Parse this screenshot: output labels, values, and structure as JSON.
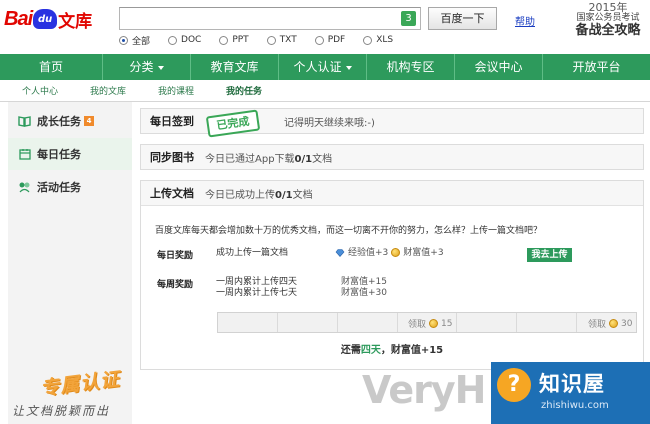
{
  "header": {
    "logo_text": "Bai",
    "logo_paw_text": "du",
    "logo_wenku": "文库",
    "search_count": "3",
    "search_button": "百度一下",
    "help_link": "帮助",
    "filters": [
      {
        "label": "全部",
        "checked": true
      },
      {
        "label": "DOC",
        "checked": false
      },
      {
        "label": "PPT",
        "checked": false
      },
      {
        "label": "TXT",
        "checked": false
      },
      {
        "label": "PDF",
        "checked": false
      },
      {
        "label": "XLS",
        "checked": false
      }
    ],
    "ad": {
      "year": "2015年",
      "line2": "国家公务员考试",
      "line3": "备战全攻略"
    }
  },
  "main_nav": [
    {
      "label": "首页",
      "dropdown": false
    },
    {
      "label": "分类",
      "dropdown": true
    },
    {
      "label": "教育文库",
      "dropdown": false
    },
    {
      "label": "个人认证",
      "dropdown": true
    },
    {
      "label": "机构专区",
      "dropdown": false
    },
    {
      "label": "会议中心",
      "dropdown": false
    },
    {
      "label": "开放平台",
      "dropdown": false
    }
  ],
  "sub_nav": [
    {
      "label": "个人中心",
      "active": false
    },
    {
      "label": "我的文库",
      "active": false
    },
    {
      "label": "我的课程",
      "active": false
    },
    {
      "label": "我的任务",
      "active": true
    }
  ],
  "sidebar": {
    "items": [
      {
        "label": "成长任务",
        "icon": "book-icon",
        "badge": "4"
      },
      {
        "label": "每日任务",
        "icon": "calendar-icon",
        "badge": ""
      },
      {
        "label": "活动任务",
        "icon": "activity-icon",
        "badge": ""
      }
    ],
    "stamp": "专属认证",
    "slogan": "让文档脱颖而出"
  },
  "tasks": {
    "daily_signin": {
      "title": "每日签到",
      "stamp": "已完成",
      "text": "记得明天继续来哦:-)"
    },
    "sync_books": {
      "title": "同步图书",
      "text_pre": "今日已通过App下载",
      "count": "0/1",
      "text_post": "文档"
    },
    "upload_doc": {
      "title": "上传文档",
      "text_pre": "今日已成功上传",
      "count": "0/1",
      "text_post": "文档",
      "intro": "百度文库每天都会增加数十万的优秀文档，而这一切离不开你的努力，怎么样？上传一篇文档吧？",
      "daily_reward": {
        "label": "每日奖励",
        "desc": "成功上传一篇文档",
        "exp": "经验值+3",
        "wealth": "财富值+3",
        "button": "我去上传"
      },
      "weekly_reward": {
        "label": "每周奖励",
        "desc1": "一周内累计上传四天",
        "desc2": "一周内累计上传七天",
        "val1": "财富值+15",
        "val2": "财富值+30"
      },
      "progress": {
        "days_total": 7,
        "days_done": 0,
        "milestone1": {
          "label": "领取",
          "value": "15"
        },
        "milestone2": {
          "label": "领取",
          "value": "30"
        }
      },
      "need": {
        "pre": "还需",
        "days": "四天",
        "post": "，财富值+15"
      }
    }
  },
  "watermarks": {
    "very": "VeryH",
    "zhi_icon": "?",
    "zhi_title": "知识屋",
    "zhi_url": "zhishiwu.com"
  },
  "colors": {
    "brand_green": "#2d9a5c",
    "brand_red": "#e10601",
    "brand_blue": "#2932e1"
  }
}
